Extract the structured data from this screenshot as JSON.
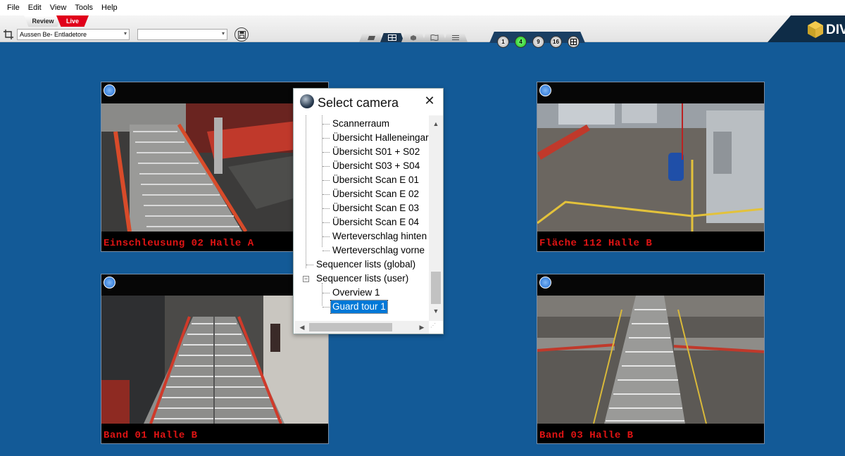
{
  "menu": {
    "items": [
      "File",
      "Edit",
      "View",
      "Tools",
      "Help"
    ]
  },
  "toolbar": {
    "mode_review": "Review",
    "mode_live": "Live",
    "site_select": "Aussen Be- Entladetore",
    "second_select": "",
    "layout_buttons": [
      "1",
      "4",
      "9",
      "16"
    ],
    "active_layout": "4",
    "logo_text": "DIV"
  },
  "cameras": [
    {
      "caption": "Einschleusung 02 Halle A"
    },
    {
      "caption": "Fläche 112 Halle B"
    },
    {
      "caption": "Band 01 Halle B"
    },
    {
      "caption": "Band 03 Halle B"
    }
  ],
  "dialog": {
    "title": "Select camera",
    "tree": [
      {
        "label": "Scannerraum",
        "level": 2
      },
      {
        "label": "Übersicht Halleneingar",
        "level": 2
      },
      {
        "label": "Übersicht S01 + S02",
        "level": 2
      },
      {
        "label": "Übersicht S03 + S04",
        "level": 2
      },
      {
        "label": "Übersicht Scan E 01",
        "level": 2
      },
      {
        "label": "Übersicht Scan E 02",
        "level": 2
      },
      {
        "label": "Übersicht Scan E 03",
        "level": 2
      },
      {
        "label": "Übersicht Scan E 04",
        "level": 2
      },
      {
        "label": "Werteverschlag hinten",
        "level": 2
      },
      {
        "label": "Werteverschlag vorne",
        "level": 2
      },
      {
        "label": "Sequencer lists (global)",
        "level": 1
      },
      {
        "label": "Sequencer lists (user)",
        "level": 1,
        "expanded": true
      },
      {
        "label": "Overview 1",
        "level": 2
      },
      {
        "label": "Guard tour 1",
        "level": 2,
        "selected": true
      }
    ]
  },
  "colors": {
    "background": "#135a97",
    "live_tab": "#e0001a",
    "caption": "#e01414",
    "selection": "#0078d7",
    "active_layout": "#1bbf1b"
  }
}
